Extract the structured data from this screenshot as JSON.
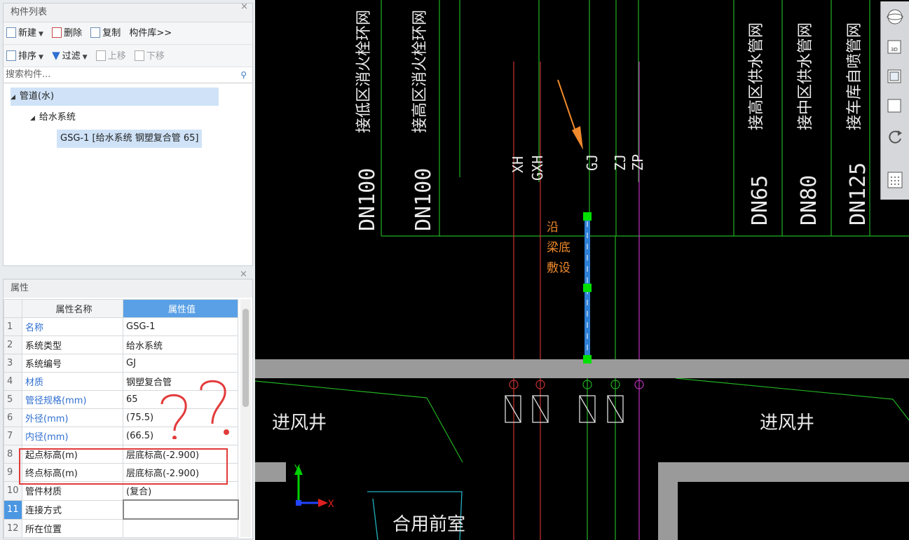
{
  "component_panel": {
    "title": "构件列表",
    "close": "×",
    "toolbar1": [
      {
        "label": "新建",
        "icon": "new-icon",
        "dropdown": true
      },
      {
        "label": "删除",
        "icon": "delete-icon"
      },
      {
        "label": "复制",
        "icon": "copy-icon"
      },
      {
        "label": "构件库>>"
      }
    ],
    "toolbar2": [
      {
        "label": "排序",
        "icon": "sort-icon",
        "dropdown": true,
        "enabled": true
      },
      {
        "label": "过滤",
        "icon": "filter-icon",
        "dropdown": true,
        "enabled": true
      },
      {
        "label": "上移",
        "icon": "move-up-icon",
        "enabled": false
      },
      {
        "label": "下移",
        "icon": "move-down-icon",
        "enabled": false
      }
    ],
    "search_placeholder": "搜索构件...",
    "tree": [
      {
        "label": "管道(水)",
        "level": 0,
        "expanded": true
      },
      {
        "label": "给水系统",
        "level": 1,
        "expanded": true
      },
      {
        "label": "GSG-1 [给水系统 钢塑复合管 65]",
        "level": 2,
        "selected": true
      }
    ]
  },
  "properties_panel": {
    "title": "属性",
    "close": "×",
    "col_name": "属性名称",
    "col_value": "属性值",
    "rows": [
      {
        "num": "1",
        "name": "名称",
        "value": "GSG-1",
        "blue": true
      },
      {
        "num": "2",
        "name": "系统类型",
        "value": "给水系统",
        "blue": false
      },
      {
        "num": "3",
        "name": "系统编号",
        "value": "GJ",
        "blue": false
      },
      {
        "num": "4",
        "name": "材质",
        "value": "钢塑复合管",
        "blue": true
      },
      {
        "num": "5",
        "name": "管径规格(mm)",
        "value": "65",
        "blue": true
      },
      {
        "num": "6",
        "name": "外径(mm)",
        "value": "(75.5)",
        "blue": true
      },
      {
        "num": "7",
        "name": "内径(mm)",
        "value": "(66.5)",
        "blue": true
      },
      {
        "num": "8",
        "name": "起点标高(m)",
        "value": "层底标高(-2.900)",
        "blue": false
      },
      {
        "num": "9",
        "name": "终点标高(m)",
        "value": "层底标高(-2.900)",
        "blue": false
      },
      {
        "num": "10",
        "name": "管件材质",
        "value": "(复合)",
        "blue": false
      },
      {
        "num": "11",
        "name": "连接方式",
        "value": "",
        "blue": false,
        "active": true
      },
      {
        "num": "12",
        "name": "所在位置",
        "value": "",
        "blue": false
      }
    ]
  },
  "drawing": {
    "vertical_labels": [
      "接低区消火栓环网",
      "接高区消火栓环网",
      "接高区供水管网",
      "接中区供水管网",
      "接车库自喷管网"
    ],
    "dn_labels": [
      "DN100",
      "DN100",
      "DN65",
      "DN80",
      "DN125"
    ],
    "pipe_codes": [
      "XH",
      "GXH",
      "GJ",
      "ZJ",
      "ZP"
    ],
    "annotation": [
      "沿",
      "梁底",
      "敷设"
    ],
    "rooms": [
      "进风井",
      "进风井",
      "合用前室"
    ],
    "axis_x": "X",
    "axis_y": "Y",
    "colors": {
      "cad_bg": "#000000",
      "green": "#22b022",
      "red": "#c83232",
      "selected": "#2e7fd6",
      "annotation": "#f08a2c",
      "beam": "#9a9a9a",
      "magenta": "#c030c0"
    }
  },
  "right_toolbar": {
    "icons": [
      "orbit-icon",
      "3d-view-icon",
      "top-view-icon",
      "front-view-icon",
      "rotate-icon",
      "grid-icon"
    ],
    "labels": [
      "3D"
    ]
  }
}
